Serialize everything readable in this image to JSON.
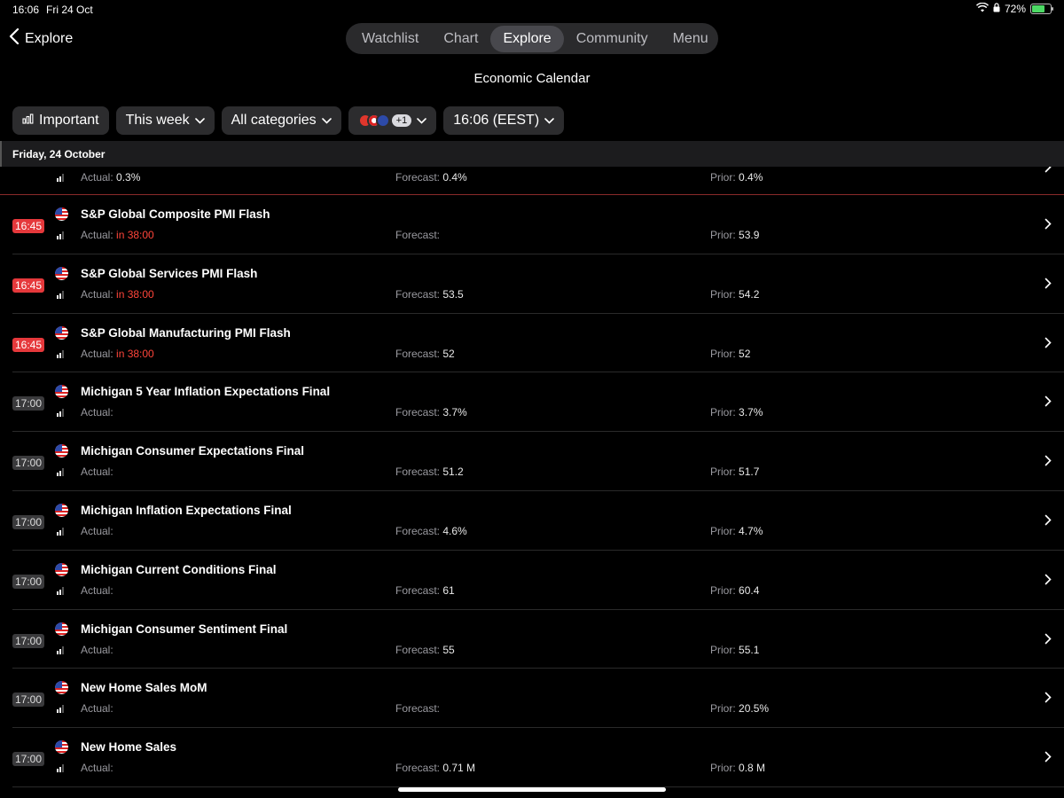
{
  "status": {
    "time": "16:06",
    "date": "Fri 24 Oct",
    "battery": "72%",
    "battery_level": 0.72
  },
  "nav": {
    "back_label": "Explore",
    "tabs": [
      "Watchlist",
      "Chart",
      "Explore",
      "Community",
      "Menu"
    ],
    "active_tab": "Explore"
  },
  "page_title": "Economic Calendar",
  "filters": {
    "important": "Important",
    "period": "This week",
    "categories": "All categories",
    "flags_extra": "+1",
    "timezone": "16:06 (EEST)"
  },
  "day_header": "Friday, 24 October",
  "partial_row": {
    "actual_label": "Actual:",
    "actual": "0.3%",
    "forecast_label": "Forecast:",
    "forecast": "0.4%",
    "prior_label": "Prior:",
    "prior": "0.4%"
  },
  "labels": {
    "actual": "Actual:",
    "forecast": "Forecast:",
    "prior": "Prior:"
  },
  "events": [
    {
      "time": "16:45",
      "soon": true,
      "name": "S&P Global Composite PMI Flash",
      "actual": "in 38:00",
      "forecast": "",
      "prior": "53.9"
    },
    {
      "time": "16:45",
      "soon": true,
      "name": "S&P Global Services PMI Flash",
      "actual": "in 38:00",
      "forecast": "53.5",
      "prior": "54.2"
    },
    {
      "time": "16:45",
      "soon": true,
      "name": "S&P Global Manufacturing PMI Flash",
      "actual": "in 38:00",
      "forecast": "52",
      "prior": "52"
    },
    {
      "time": "17:00",
      "soon": false,
      "name": "Michigan 5 Year Inflation Expectations Final",
      "actual": "",
      "forecast": "3.7%",
      "prior": "3.7%"
    },
    {
      "time": "17:00",
      "soon": false,
      "name": "Michigan Consumer Expectations Final",
      "actual": "",
      "forecast": "51.2",
      "prior": "51.7"
    },
    {
      "time": "17:00",
      "soon": false,
      "name": "Michigan Inflation Expectations Final",
      "actual": "",
      "forecast": "4.6%",
      "prior": "4.7%"
    },
    {
      "time": "17:00",
      "soon": false,
      "name": "Michigan Current Conditions Final",
      "actual": "",
      "forecast": "61",
      "prior": "60.4"
    },
    {
      "time": "17:00",
      "soon": false,
      "name": "Michigan Consumer Sentiment Final",
      "actual": "",
      "forecast": "55",
      "prior": "55.1"
    },
    {
      "time": "17:00",
      "soon": false,
      "name": "New Home Sales MoM",
      "actual": "",
      "forecast": "",
      "prior": "20.5%"
    },
    {
      "time": "17:00",
      "soon": false,
      "name": "New Home Sales",
      "actual": "",
      "forecast": "0.71 M",
      "prior": "0.8 M"
    }
  ],
  "colors": {
    "accent_red": "#e5383b",
    "background": "#000000",
    "chip": "#2c2c2e"
  }
}
